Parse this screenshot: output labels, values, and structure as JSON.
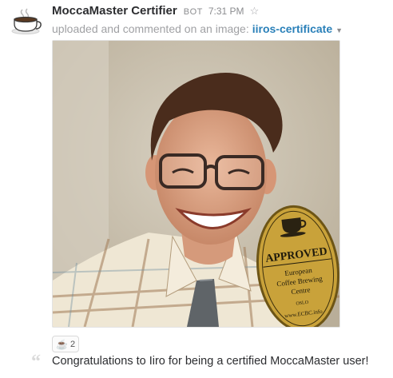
{
  "message": {
    "sender": "MoccaMaster Certifier",
    "bot_label": "BOT",
    "time": "7:31 PM",
    "action_text": "uploaded and commented on an image:",
    "file_name": "iiros-certificate"
  },
  "image": {
    "badge": {
      "approved": "APPROVED",
      "line1": "European",
      "line2": "Coffee Brewing",
      "line3": "Centre",
      "city": "OSLO",
      "url": "www.ECBC.info"
    }
  },
  "reaction": {
    "emoji": "☕",
    "count": "2"
  },
  "comment": {
    "text": "Congratulations to Iiro for being a certified MoccaMaster user!"
  },
  "icons": {
    "avatar": "coffee-cup-icon",
    "star": "star-icon",
    "caret": "caret-down-icon",
    "quote": "quote-icon"
  },
  "colors": {
    "link": "#2a80b9",
    "badge_gold": "#c9a23a"
  }
}
